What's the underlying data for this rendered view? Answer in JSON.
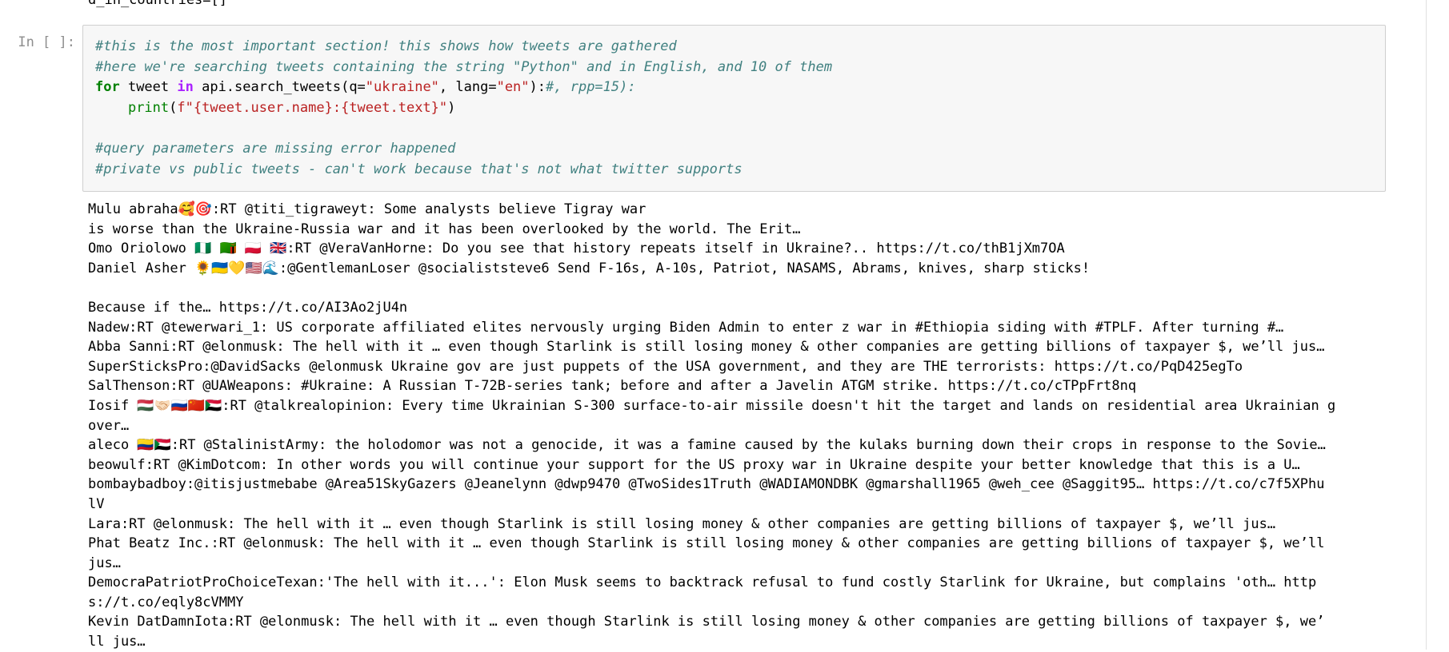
{
  "previous_output_tail": "d_in_countries=[]",
  "cell": {
    "prompt": "In [ ]:",
    "code_lines": [
      [
        {
          "t": "#this is the most important section! this shows how tweets are gathered",
          "c": "comment"
        }
      ],
      [
        {
          "t": "#here we're searching tweets containing the string \"Python\" and in English, and 10 of them",
          "c": "comment"
        }
      ],
      [
        {
          "t": "for",
          "c": "keyword"
        },
        {
          "t": " tweet ",
          "c": ""
        },
        {
          "t": "in",
          "c": "operator"
        },
        {
          "t": " api.search_tweets(q=",
          "c": ""
        },
        {
          "t": "\"ukraine\"",
          "c": "string"
        },
        {
          "t": ", lang=",
          "c": ""
        },
        {
          "t": "\"en\"",
          "c": "string"
        },
        {
          "t": "):",
          "c": ""
        },
        {
          "t": "#, rpp=15):",
          "c": "comment"
        }
      ],
      [
        {
          "t": "    ",
          "c": ""
        },
        {
          "t": "print",
          "c": "builtin"
        },
        {
          "t": "(",
          "c": ""
        },
        {
          "t": "f\"{tweet.user.name}:{tweet.text}\"",
          "c": "string"
        },
        {
          "t": ")",
          "c": ""
        }
      ],
      [
        {
          "t": "",
          "c": ""
        }
      ],
      [
        {
          "t": "#query parameters are missing error happened",
          "c": "comment"
        }
      ],
      [
        {
          "t": "#private vs public tweets - can't work because that's not what twitter supports",
          "c": "comment"
        }
      ]
    ],
    "output_lines": [
      "Mulu abraha🥰🎯:RT @titi_tigraweyt: Some analysts believe Tigray war",
      "is worse than the Ukraine-Russia war and it has been overlooked by the world. The Erit…",
      "Omo Oriolowo 🇳🇬 🇿🇲 🇵🇱 🇬🇧:RT @VeraVanHorne: Do you see that history repeats itself in Ukraine?.. https://t.co/thB1jXm7OA",
      "Daniel Asher 🌻🇺🇦💛🇺🇸🌊:@GentlemanLoser @socialiststeve6 Send F-16s, A-10s, Patriot, NASAMS, Abrams, knives, sharp sticks!",
      "",
      "Because if the… https://t.co/AI3Ao2jU4n",
      "Nadew:RT @tewerwari_1: US corporate affiliated elites nervously urging Biden Admin to enter z war in #Ethiopia siding with #TPLF. After turning #…",
      "Abba Sanni:RT @elonmusk: The hell with it … even though Starlink is still losing money & other companies are getting billions of taxpayer $, we’ll jus…",
      "SuperSticksPro:@DavidSacks @elonmusk Ukraine gov are just puppets of the USA government, and they are THE terrorists: https://t.co/PqD425egTo",
      "SalThenson:RT @UAWeapons: #Ukraine: A Russian T-72B-series tank; before and after a Javelin ATGM strike. https://t.co/cTPpFrt8nq",
      "Iosif 🇭🇺🤝🏻🇷🇺🇨🇳🇸🇩:RT @talkrealopinion: Every time Ukrainian S-300 surface-to-air missile doesn't hit the target and lands on residential area Ukrainian g",
      "over…",
      "aleco 🇨🇴🇸🇩:RT @StalinistArmy: the holodomor was not a genocide, it was a famine caused by the kulaks burning down their crops in response to the Sovie…",
      "beowulf:RT @KimDotcom: In other words you will continue your support for the US proxy war in Ukraine despite your better knowledge that this is a U…",
      "bombaybadboy:@itisjustmebabe @Area51SkyGazers @Jeanelynn @dwp9470 @TwoSides1Truth @WADIAMONDBK @gmarshall1965 @weh_cee @Saggit95… https://t.co/c7f5XPhu",
      "lV",
      "Lara:RT @elonmusk: The hell with it … even though Starlink is still losing money & other companies are getting billions of taxpayer $, we’ll jus…",
      "Phat Beatz Inc.:RT @elonmusk: The hell with it … even though Starlink is still losing money & other companies are getting billions of taxpayer $, we’ll",
      "jus…",
      "DemocraPatriotProChoiceTexan:'The hell with it...': Elon Musk seems to backtrack refusal to fund costly Starlink for Ukraine, but complains 'oth… http",
      "s://t.co/eqly8cVMMY",
      "Kevin DatDamnIota:RT @elonmusk: The hell with it … even though Starlink is still losing money & other companies are getting billions of taxpayer $, we’",
      "ll jus…"
    ]
  }
}
